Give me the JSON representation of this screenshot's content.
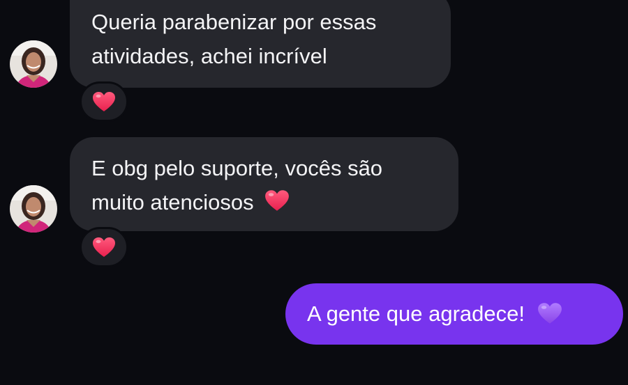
{
  "messages": [
    {
      "direction": "incoming",
      "lines": [
        "Queria parabenizar por essas",
        "atividades, achei incrível"
      ],
      "reaction": "red-heart-icon"
    },
    {
      "direction": "incoming",
      "lines": [
        "E obg pelo suporte, vocês são",
        "muito atenciosos"
      ],
      "inline_icon": "red-heart-icon",
      "reaction": "red-heart-icon"
    },
    {
      "direction": "outgoing",
      "text": "A gente que agradece!",
      "inline_icon": "purple-heart-icon"
    }
  ],
  "colors": {
    "background": "#0a0b10",
    "incoming_bubble": "#26272d",
    "outgoing_bubble": "#7834ee",
    "heart_red": "#f0335f",
    "heart_purple": "#9b5cf0"
  }
}
